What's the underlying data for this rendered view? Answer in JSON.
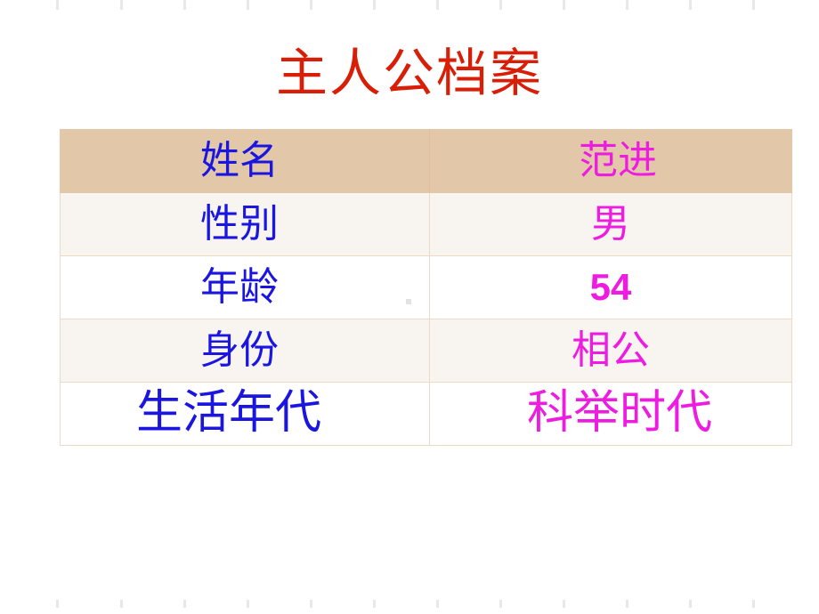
{
  "slide": {
    "title": "主人公档案",
    "title_color": "#d81e06",
    "background_color": "#ffffff"
  },
  "colors": {
    "label_text": "#1a16e0",
    "value_text": "#ee1ce0",
    "header_row_fill": "#e2c7a9",
    "alt_row_fill": "#f8f4ef",
    "plain_row_fill": "#ffffff",
    "border": "#eed9c4",
    "tick_mark": "#e8e8e8"
  },
  "table": {
    "rows": [
      {
        "label": "姓名",
        "value": "范进",
        "style": "tan"
      },
      {
        "label": "性别",
        "value": "男",
        "style": "cream"
      },
      {
        "label": "年龄",
        "value": "54",
        "style": "white"
      },
      {
        "label": "身份",
        "value": "相公",
        "style": "cream"
      },
      {
        "label": "生活年代",
        "value": "科举时代",
        "style": "white"
      }
    ]
  },
  "ruler": {
    "top_tick_x": [
      63,
      135,
      206,
      277,
      348,
      419,
      490,
      561,
      632,
      703,
      774,
      845
    ],
    "bottom_tick_x": [
      63,
      135,
      206,
      277,
      348,
      419,
      490,
      561,
      632,
      703,
      774,
      845
    ]
  }
}
